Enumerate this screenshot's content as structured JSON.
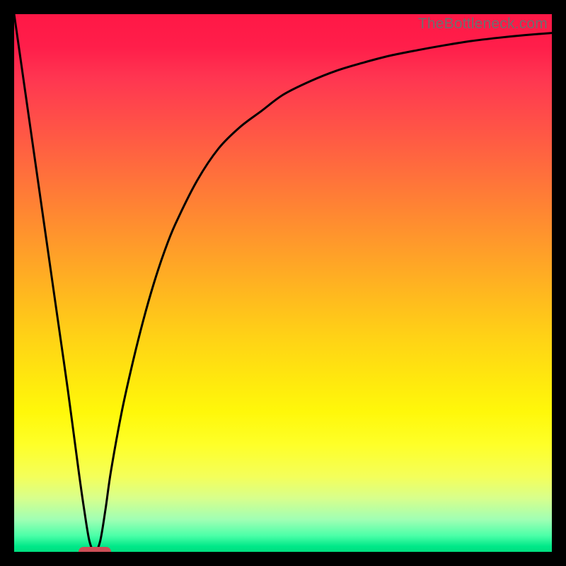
{
  "watermark": "TheBottleneck.com",
  "colors": {
    "background": "#000000",
    "curve": "#000000",
    "marker": "#cc4f57"
  },
  "chart_data": {
    "type": "line",
    "title": "",
    "xlabel": "",
    "ylabel": "",
    "xlim": [
      0,
      100
    ],
    "ylim": [
      0,
      100
    ],
    "x": [
      0,
      2,
      4,
      6,
      8,
      10,
      12,
      13,
      14,
      15,
      16,
      17,
      18,
      20,
      22,
      24,
      26,
      28,
      30,
      34,
      38,
      42,
      46,
      50,
      55,
      60,
      65,
      70,
      75,
      80,
      85,
      90,
      95,
      100
    ],
    "series": [
      {
        "name": "bottleneck-curve",
        "values": [
          100,
          86,
          72,
          58,
          44,
          30,
          15,
          8,
          2,
          0,
          2,
          8,
          15,
          26,
          35,
          43,
          50,
          56,
          61,
          69,
          75,
          79,
          82,
          85,
          87.5,
          89.5,
          91,
          92.3,
          93.3,
          94.2,
          95,
          95.6,
          96.1,
          96.5
        ]
      }
    ],
    "marker": {
      "x": 15,
      "y": 0,
      "width": 6
    },
    "gradient_stops": [
      {
        "pct": 0,
        "color": "#ff1846"
      },
      {
        "pct": 20,
        "color": "#ff5048"
      },
      {
        "pct": 44,
        "color": "#ff9e29"
      },
      {
        "pct": 68,
        "color": "#ffe80e"
      },
      {
        "pct": 86,
        "color": "#f4ff5a"
      },
      {
        "pct": 97,
        "color": "#4bffa8"
      },
      {
        "pct": 100,
        "color": "#00df80"
      }
    ]
  }
}
